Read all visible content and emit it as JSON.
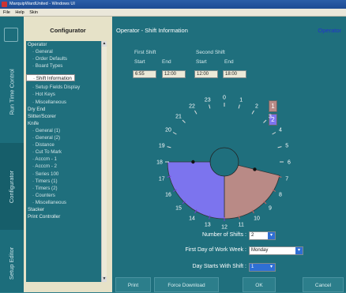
{
  "window": {
    "title": "MarquipWardUnited - Windows UI"
  },
  "menu": [
    "File",
    "Help",
    "Skin"
  ],
  "sidebar": {
    "header": "Configurator",
    "vtabs": [
      "Run Time Control",
      "Configurator",
      "Setup Editor"
    ],
    "tree": [
      {
        "label": "Operator",
        "kind": "g"
      },
      {
        "label": "General",
        "kind": "c"
      },
      {
        "label": "Order Defaults",
        "kind": "c"
      },
      {
        "label": "Board Types",
        "kind": "c"
      },
      {
        "label": "Shift Information",
        "kind": "c",
        "selected": true
      },
      {
        "label": "Setup Fields Display",
        "kind": "c"
      },
      {
        "label": "Hot Keys",
        "kind": "c"
      },
      {
        "label": "Miscellaneous",
        "kind": "c"
      },
      {
        "label": "Dry End",
        "kind": "g"
      },
      {
        "label": "Slitter/Scorer",
        "kind": "g"
      },
      {
        "label": "Knife",
        "kind": "g"
      },
      {
        "label": "General (1)",
        "kind": "c"
      },
      {
        "label": "General (2)",
        "kind": "c"
      },
      {
        "label": "Distance",
        "kind": "c"
      },
      {
        "label": "Cut To Mark",
        "kind": "c"
      },
      {
        "label": "Acccm - 1",
        "kind": "c"
      },
      {
        "label": "Acccm - 2",
        "kind": "c"
      },
      {
        "label": "Series 100",
        "kind": "c"
      },
      {
        "label": "Timers (1)",
        "kind": "c"
      },
      {
        "label": "Timers (2)",
        "kind": "c"
      },
      {
        "label": "Counters",
        "kind": "c"
      },
      {
        "label": "Miscellaneous",
        "kind": "c"
      },
      {
        "label": "Stacker",
        "kind": "g"
      },
      {
        "label": "Print Controller",
        "kind": "g"
      }
    ]
  },
  "main": {
    "title": "Operator - Shift Information",
    "badge": "Operator",
    "first_shift": {
      "label": "First Shift",
      "start_label": "Start",
      "end_label": "End",
      "start": "6:55",
      "end": "12:00"
    },
    "second_shift": {
      "label": "Second Shift",
      "start_label": "Start",
      "end_label": "End",
      "start": "12:00",
      "end": "18:00"
    },
    "legend": [
      "1",
      "2"
    ],
    "clock": {
      "hours": [
        "0",
        "1",
        "2",
        "3",
        "4",
        "5",
        "6",
        "7",
        "8",
        "9",
        "10",
        "11",
        "12",
        "13",
        "14",
        "15",
        "16",
        "17",
        "18",
        "19",
        "20",
        "21",
        "22",
        "23"
      ],
      "shift1_color": "#b98a86",
      "shift2_color": "#7c74ee"
    },
    "fields": {
      "num_shifts_label": "Number of Shifts :",
      "num_shifts": "2",
      "first_day_label": "First Day of Work Week :",
      "first_day": "Monday",
      "day_starts_label": "Day Starts With Shift :",
      "day_starts": "1"
    },
    "buttons": {
      "print": "Print",
      "force_download": "Force Download",
      "ok": "OK",
      "cancel": "Cancel"
    }
  }
}
